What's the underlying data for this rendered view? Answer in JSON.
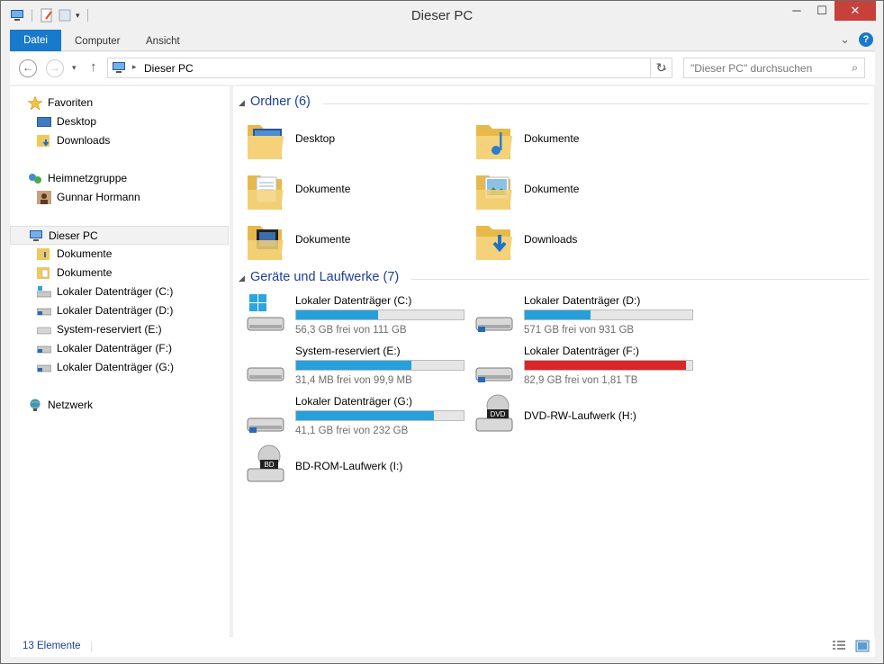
{
  "window": {
    "title": "Dieser PC",
    "controls": {
      "minimize": "─",
      "maximize": "☐",
      "close": "✕"
    }
  },
  "ribbon": {
    "tabs": [
      "Datei",
      "Computer",
      "Ansicht"
    ],
    "help": "?",
    "expand": "⌄"
  },
  "address": {
    "back": "←",
    "forward": "→",
    "recent": "▾",
    "up": "↑",
    "crumb_sep": "▸",
    "path": "Dieser PC",
    "dropdown": "⌄",
    "refresh": "↻",
    "search_placeholder": "\"Dieser PC\" durchsuchen",
    "search_glyph": "⌕"
  },
  "navpane": {
    "favorites": {
      "label": "Favoriten",
      "items": [
        "Desktop",
        "Downloads"
      ]
    },
    "homegroup": {
      "label": "Heimnetzgruppe",
      "items": [
        "Gunnar Hormann"
      ]
    },
    "thispc": {
      "label": "Dieser PC",
      "items": [
        "Dokumente",
        "Dokumente",
        "Lokaler Datenträger (C:)",
        "Lokaler Datenträger (D:)",
        "System-reserviert (E:)",
        "Lokaler Datenträger (F:)",
        "Lokaler Datenträger (G:)"
      ]
    },
    "network": {
      "label": "Netzwerk"
    }
  },
  "content": {
    "folders_group": "Ordner (6)",
    "folders": [
      "Desktop",
      "Dokumente",
      "Dokumente",
      "Dokumente",
      "Dokumente",
      "Downloads"
    ],
    "drives_group": "Geräte und Laufwerke (7)",
    "drives": [
      {
        "name": "Lokaler Datenträger (C:)",
        "free": "56,3 GB frei von 111 GB",
        "used_fraction": 0.49,
        "critical": false
      },
      {
        "name": "Lokaler Datenträger (D:)",
        "free": "571 GB frei von 931 GB",
        "used_fraction": 0.39,
        "critical": false
      },
      {
        "name": "System-reserviert (E:)",
        "free": "31,4 MB frei von 99,9 MB",
        "used_fraction": 0.69,
        "critical": false
      },
      {
        "name": "Lokaler Datenträger (F:)",
        "free": "82,9 GB frei von 1,81 TB",
        "used_fraction": 0.96,
        "critical": true
      },
      {
        "name": "Lokaler Datenträger (G:)",
        "free": "41,1 GB frei von 232 GB",
        "used_fraction": 0.82,
        "critical": false
      }
    ],
    "optical": [
      {
        "name": "DVD-RW-Laufwerk (H:)",
        "badge": "DVD"
      },
      {
        "name": "BD-ROM-Laufwerk (I:)",
        "badge": "BD"
      }
    ]
  },
  "status": {
    "count": "13 Elemente"
  },
  "colors": {
    "accent": "#1979ca",
    "bar": "#26a0da",
    "bar_critical": "#da2626",
    "group_title": "#1e3f99"
  }
}
